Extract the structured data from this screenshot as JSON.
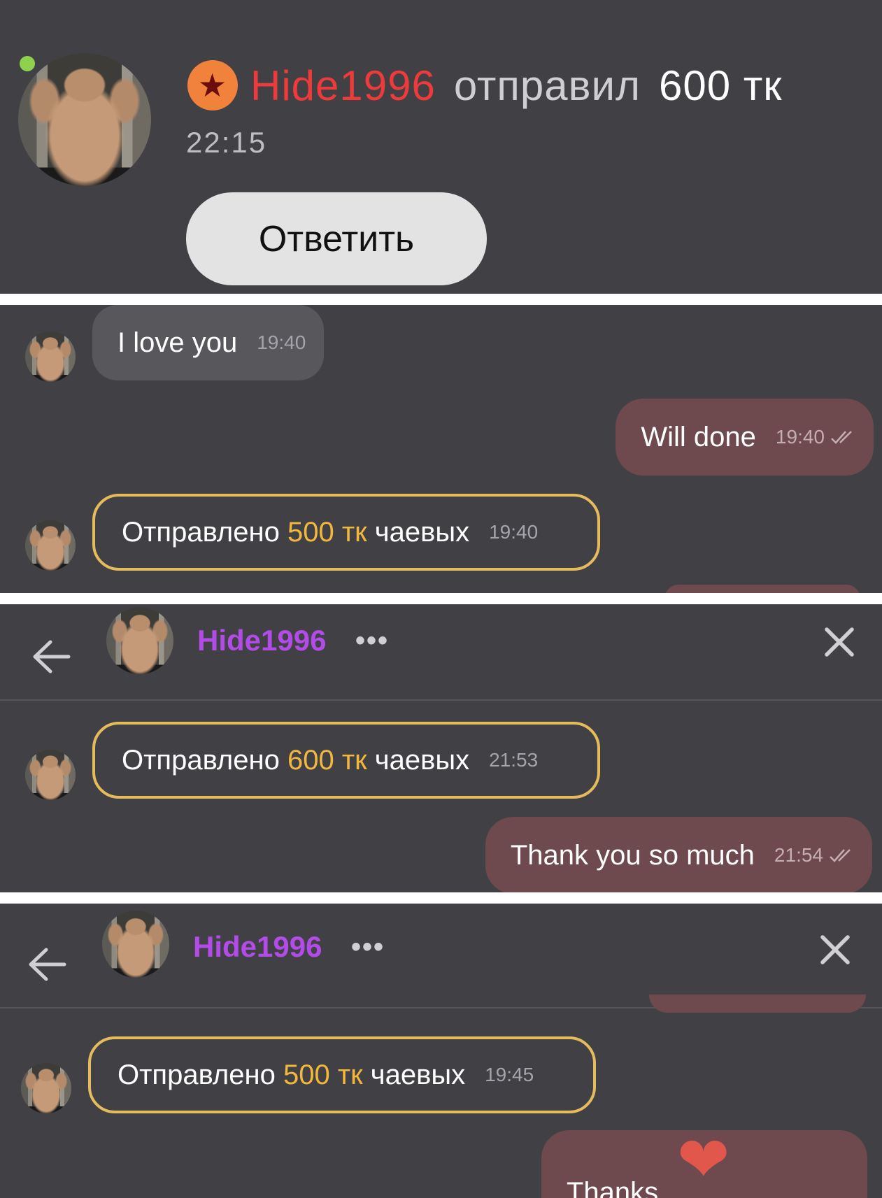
{
  "notification": {
    "sender": "Hide1996",
    "action": "отправил",
    "amount": "600 тк",
    "time": "22:15",
    "reply_label": "Ответить",
    "star_glyph": "★",
    "online_color": "#8fd14f"
  },
  "panel2": {
    "messages": [
      {
        "text": "I love you",
        "time": "19:40"
      },
      {
        "text": "Will done",
        "time": "19:40"
      }
    ],
    "tip": {
      "prefix": "Отправлено",
      "amount": "500 тк",
      "suffix": "чаевых",
      "time": "19:40"
    }
  },
  "panel3": {
    "header": {
      "name": "Hide1996",
      "more": "•••"
    },
    "tip": {
      "prefix": "Отправлено",
      "amount": "600 тк",
      "suffix": "чаевых",
      "time": "21:53"
    },
    "message": {
      "text": "Thank you so much",
      "time": "21:54"
    }
  },
  "panel4": {
    "header": {
      "name": "Hide1996",
      "more": "•••"
    },
    "tip": {
      "prefix": "Отправлено",
      "amount": "500 тк",
      "suffix": "чаевых",
      "time": "19:45"
    },
    "message": {
      "text": "Thanks",
      "heart": "❤"
    }
  },
  "colors": {
    "background": "#414145",
    "accent_name": "#b34be8",
    "sender_red": "#ee3a3a",
    "tip_gold": "#f2b73c",
    "outgoing_bubble": "#6e4a4e",
    "incoming_bubble": "#57575c"
  }
}
